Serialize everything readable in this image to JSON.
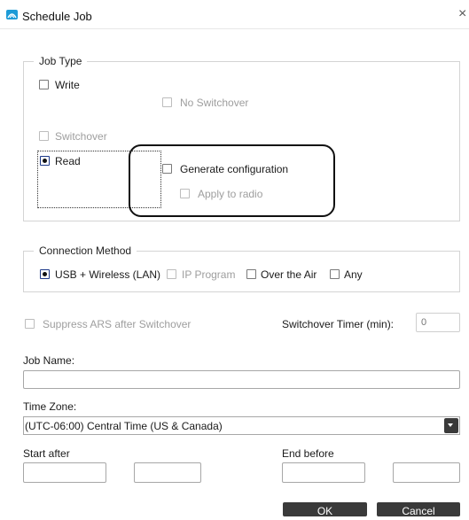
{
  "window": {
    "title": "Schedule Job",
    "close_glyph": "×",
    "icon": "app-logo-icon"
  },
  "job_type": {
    "legend": "Job Type",
    "write_label": "Write",
    "no_switchover_label": "No Switchover",
    "switchover_label": "Switchover",
    "read_label": "Read",
    "generate_configuration_label": "Generate configuration",
    "apply_to_radio_label": "Apply to radio"
  },
  "connection_method": {
    "legend": "Connection Method",
    "options": [
      "USB + Wireless (LAN)",
      "IP Program",
      "Over the Air",
      "Any"
    ],
    "selected": "USB + Wireless (LAN)"
  },
  "suppress_ars_label": "Suppress ARS after Switchover",
  "switchover_timer": {
    "label": "Switchover Timer (min):",
    "value": "0"
  },
  "job_name": {
    "label": "Job Name:",
    "value": ""
  },
  "time_zone": {
    "label": "Time Zone:",
    "value": "(UTC-06:00) Central Time (US & Canada)"
  },
  "start_after_label": "Start after",
  "end_before_label": "End before",
  "buttons": {
    "ok": "OK",
    "cancel": "Cancel"
  },
  "colors": {
    "accent": "#1d9bd7",
    "button_bg": "#3a3a3a"
  }
}
